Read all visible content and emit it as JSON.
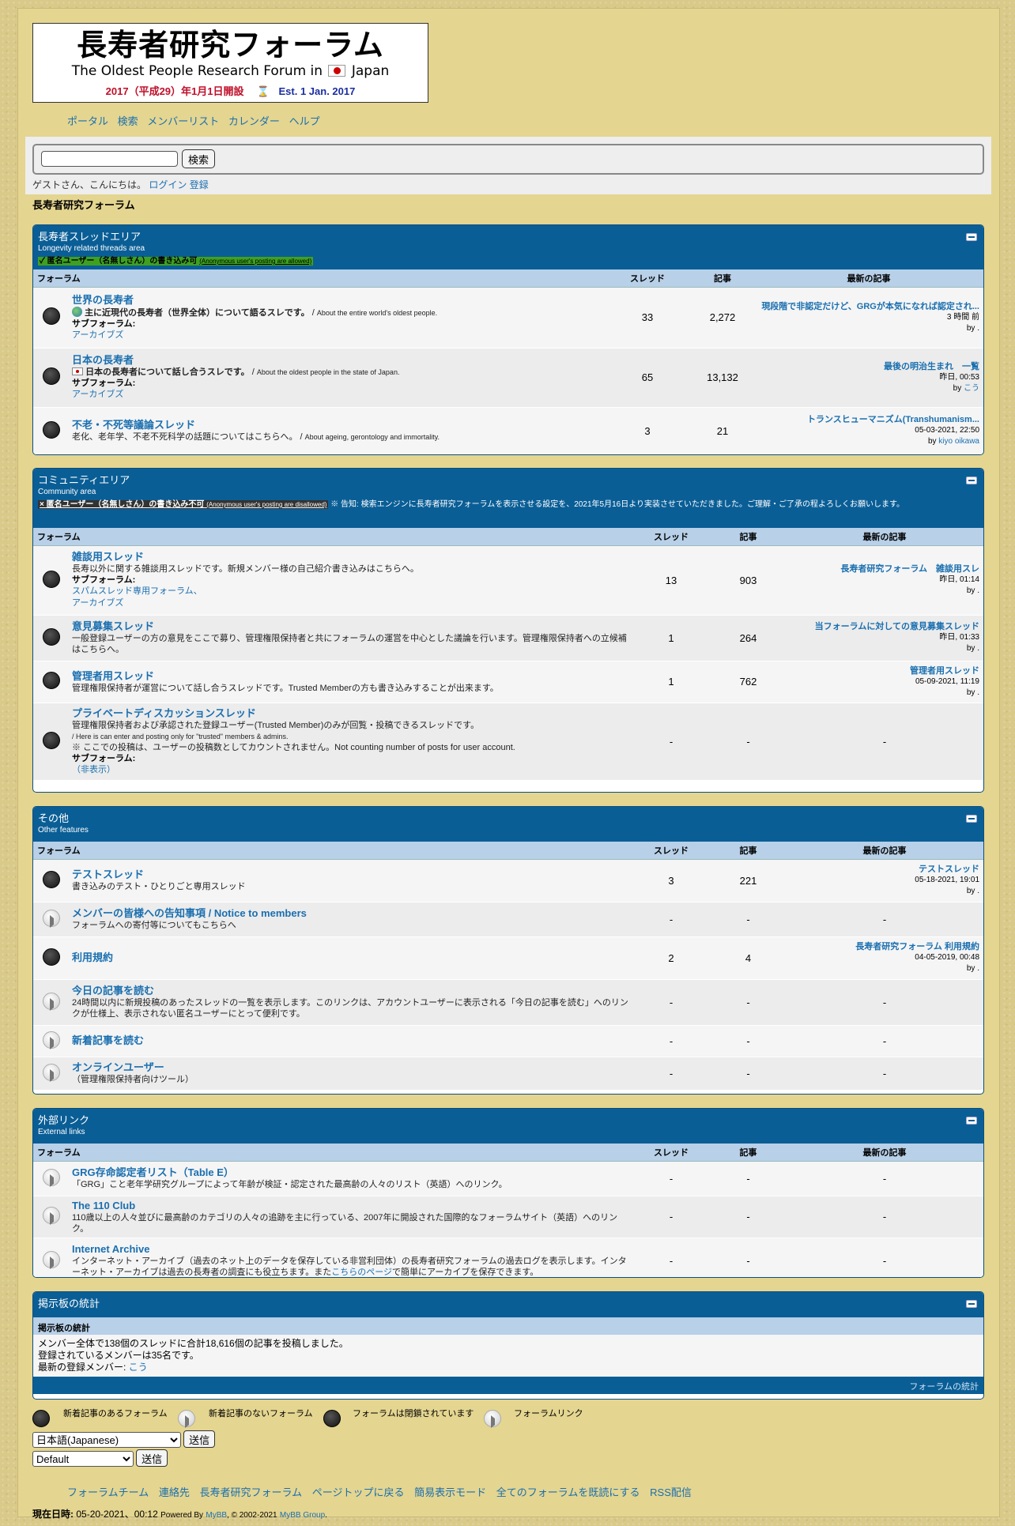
{
  "site": {
    "logo_title": "長寿者研究フォーラム",
    "logo_sub_a": "The Oldest People Research Forum in",
    "logo_sub_b": "Japan",
    "logo_est_jp": "2017（平成29）年1月1日開設",
    "logo_est_en": "Est. 1 Jan. 2017"
  },
  "topnav": [
    "ポータル",
    "検索",
    "メンバーリスト",
    "カレンダー",
    "ヘルプ"
  ],
  "search": {
    "button": "検索",
    "placeholder": ""
  },
  "welcome": {
    "text": "ゲストさん、こんにちは。",
    "login": "ログイン",
    "register": "登録"
  },
  "breadcrumb": "長寿者研究フォーラム",
  "cols": {
    "forum": "フォーラム",
    "threads": "スレッド",
    "posts": "記事",
    "last": "最新の記事"
  },
  "cat1": {
    "name": "長寿者スレッドエリア",
    "sub": "Longevity related threads area",
    "note": "✓ 匿名ユーザー（名無しさん）の書き込み可",
    "note_en": "(Anonymous user's posting are allowed)",
    "forums": [
      {
        "title": "世界の長寿者",
        "desc": "主に近現代の長寿者（世界全体）について語るスレです。",
        "desc_en": "About the entire world's oldest people.",
        "subforums_label": "サブフォーラム:",
        "subforums": "アーカイブズ",
        "threads": "33",
        "posts": "2,272",
        "last_title": "現段階で非認定だけど、GRGが本気になれば認定され...",
        "last_time": "3 時間 前",
        "last_by": "by ."
      },
      {
        "title": "日本の長寿者",
        "desc": "日本の長寿者について話し合うスレです。",
        "desc_en": "About the oldest people in the state of Japan.",
        "subforums_label": "サブフォーラム:",
        "subforums": "アーカイブズ",
        "threads": "65",
        "posts": "13,132",
        "last_title": "最後の明治生まれ　一覧",
        "last_time": "昨日, 00:53",
        "last_by": "by",
        "last_user": "こう"
      },
      {
        "title": "不老・不死等議論スレッド",
        "desc": "老化、老年学、不老不死科学の話題についてはこちらへ。",
        "desc_en": "About ageing, gerontology and immortality.",
        "threads": "3",
        "posts": "21",
        "last_title": "トランスヒューマニズム(Transhumanism...",
        "last_time": "05-03-2021, 22:50",
        "last_by": "by",
        "last_user": "kiyo oikawa"
      }
    ]
  },
  "cat2": {
    "name": "コミュニティエリア",
    "sub": "Community area",
    "note": "× 匿名ユーザー（名無しさん）の書き込み不可",
    "note_en": "(Anonymous user's posting are disallowed)",
    "notice": " ※ 告知: 検索エンジンに長寿者研究フォーラムを表示させる設定を、2021年5月16日より実装させていただきました。ご理解・ご了承の程よろしくお願いします。",
    "forums": [
      {
        "title": "雑談用スレッド",
        "desc": "長寿以外に関する雑談用スレッドです。新規メンバー様の自己紹介書き込みはこちらへ。",
        "subforums_label": "サブフォーラム:",
        "sub1": "スパムスレッド専用フォーラム、",
        "sub2": "アーカイブズ",
        "threads": "13",
        "posts": "903",
        "last_title": "長寿者研究フォーラム　雑談用スレ",
        "last_time": "昨日, 01:14",
        "last_by": "by ."
      },
      {
        "title": "意見募集スレッド",
        "desc": "一般登録ユーザーの方の意見をここで募り、管理権限保持者と共にフォーラムの運営を中心とした議論を行います。管理権限保持者への立候補はこちらへ。",
        "threads": "1",
        "posts": "264",
        "last_title": "当フォーラムに対しての意見募集スレッド",
        "last_time": "昨日, 01:33",
        "last_by": "by ."
      },
      {
        "title": "管理者用スレッド",
        "desc": "管理権限保持者が運営について話し合うスレッドです。Trusted Memberの方も書き込みすることが出来ます。",
        "threads": "1",
        "posts": "762",
        "last_title": "管理者用スレッド",
        "last_time": "05-09-2021, 11:19",
        "last_by": "by ."
      },
      {
        "title": "プライベートディスカッションスレッド",
        "desc": "管理権限保持者および承認された登録ユーザー(Trusted Member)のみが回覧・投稿できるスレッドです。",
        "desc2": "/ Here is can enter and posting only for \"trusted\" members & admins.",
        "desc3": "※ ここでの投稿は、ユーザーの投稿数としてカウントされません。Not counting number of posts for user account.",
        "subforums_label": "サブフォーラム:",
        "subforums": "（非表示）",
        "threads": "-",
        "posts": "-",
        "last": "-"
      }
    ]
  },
  "cat3": {
    "name": "その他",
    "sub": "Other features",
    "forums": [
      {
        "title": "テストスレッド",
        "desc": "書き込みのテスト・ひとりごと専用スレッド",
        "threads": "3",
        "posts": "221",
        "last_title": "テストスレッド",
        "last_time": "05-18-2021, 19:01",
        "last_by": "by ."
      },
      {
        "title": "メンバーの皆様への告知事項 / Notice to members",
        "desc": "フォーラムへの寄付等についてもこちらへ",
        "threads": "-",
        "posts": "-",
        "last": "-"
      },
      {
        "title": "利用規約",
        "threads": "2",
        "posts": "4",
        "last_title": "長寿者研究フォーラム 利用規約",
        "last_time": "04-05-2019, 00:48",
        "last_by": "by ."
      },
      {
        "title": "今日の記事を読む",
        "desc": "24時間以内に新規投稿のあったスレッドの一覧を表示します。このリンクは、アカウントユーザーに表示される「今日の記事を読む」へのリンクが仕様上、表示されない匿名ユーザーにとって便利です。",
        "threads": "-",
        "posts": "-",
        "last": "-"
      },
      {
        "title": "新着記事を読む",
        "threads": "-",
        "posts": "-",
        "last": "-"
      },
      {
        "title": "オンラインユーザー",
        "desc": "（管理権限保持者向けツール）",
        "threads": "-",
        "posts": "-",
        "last": "-"
      }
    ]
  },
  "cat4": {
    "name": "外部リンク",
    "sub": "External links",
    "forums": [
      {
        "title": "GRG存命認定者リスト（Table E）",
        "desc": "「GRG」こと老年学研究グループによって年齢が検証・認定された最高齢の人々のリスト（英語）へのリンク。",
        "threads": "-",
        "posts": "-",
        "last": "-"
      },
      {
        "title": "The 110 Club",
        "desc": "110歳以上の人々並びに最高齢のカテゴリの人々の追跡を主に行っている、2007年に開設された国際的なフォーラムサイト（英語）へのリンク。",
        "threads": "-",
        "posts": "-",
        "last": "-"
      },
      {
        "title": "Internet Archive",
        "desc": "インターネット・アーカイブ（過去のネット上のデータを保存している非営利団体）の長寿者研究フォーラムの過去ログを表示します。インターネット・アーカイブは過去の長寿者の調査にも役立ちます。また",
        "desc_link": "こちらのページ",
        "desc_tail": "で簡単にアーカイブを保存できます。",
        "threads": "-",
        "posts": "-",
        "last": "-"
      }
    ]
  },
  "stats": {
    "name": "掲示板の統計",
    "head": "掲示板の統計",
    "line1": "メンバー全体で138個のスレッドに合計18,616個の記事を投稿しました。",
    "line2": "登録されているメンバーは35名です。",
    "line3": "最新の登録メンバー: ",
    "newest": "こう",
    "foot": "フォーラムの統計"
  },
  "legend": {
    "new": "新着記事のあるフォーラム",
    "nonew": "新着記事のないフォーラム",
    "locked": "フォーラムは閉鎖されています",
    "link": "フォーラムリンク"
  },
  "lang_select": "日本語(Japanese)",
  "theme_select": "Default",
  "go": "送信",
  "footnav": [
    "フォーラムチーム",
    "連絡先",
    "長寿者研究フォーラム",
    "ページトップに戻る",
    "簡易表示モード",
    "全てのフォーラムを既読にする",
    "RSS配信"
  ],
  "copyright": {
    "label": "現在日時:",
    "time": "05-20-2021、00:12",
    "powered": "Powered By",
    "mybb": "MyBB",
    "years": ", © 2002-2021",
    "group": "MyBB Group",
    "dot": "."
  }
}
